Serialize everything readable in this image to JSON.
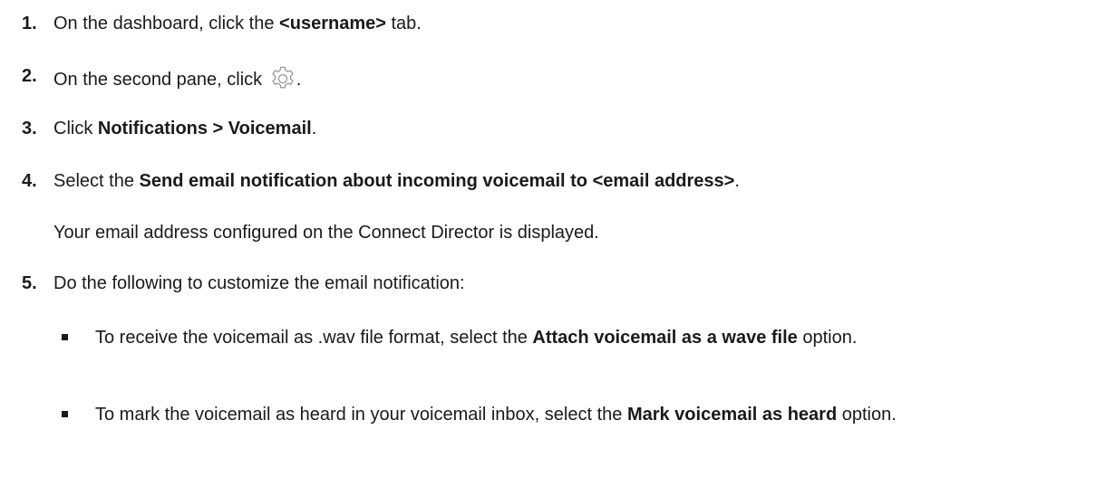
{
  "steps": [
    {
      "number": "1.",
      "pre": "On the dashboard, click the ",
      "bold": "<username>",
      "post": " tab."
    },
    {
      "number": "2.",
      "pre": "On the second pane, click ",
      "icon": "gear-icon",
      "post": "."
    },
    {
      "number": "3.",
      "pre": "Click ",
      "bold": "Notifications > Voicemail",
      "post": "."
    },
    {
      "number": "4.",
      "pre": "Select the ",
      "bold": "Send email notification about incoming voicemail to <email address>",
      "post": ".",
      "note": "Your email address configured on the Connect Director is displayed."
    },
    {
      "number": "5.",
      "pre": "Do the following to customize the email notification:",
      "bullets": [
        {
          "pre": "To receive the voicemail as .wav file format, select the ",
          "bold": "Attach voicemail as a wave file",
          "post": " option."
        },
        {
          "pre": "To mark the voicemail as heard in your voicemail inbox, select the ",
          "bold": "Mark voicemail as heard",
          "post": " option."
        }
      ]
    }
  ],
  "colors": {
    "text": "#1a1a1a",
    "icon": "#8a8a8a"
  }
}
